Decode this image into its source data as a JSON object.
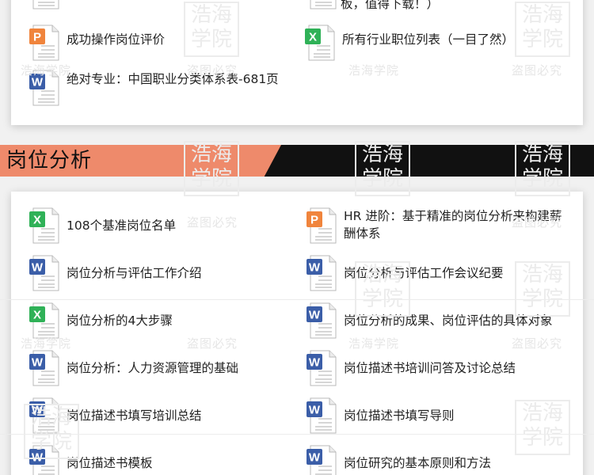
{
  "top_items": [
    {
      "type": "ppt",
      "label": "成功操作岗位评价"
    },
    {
      "type": "excel",
      "label": "所有行业职位列表（一目了然）"
    },
    {
      "type": "word",
      "label": "绝对专业：中国职业分类体系表-681页"
    }
  ],
  "top_partial_text": "板，值得下载！）",
  "section": {
    "title": "岗位分析"
  },
  "items": [
    {
      "type": "excel",
      "label": "108个基准岗位名单"
    },
    {
      "type": "ppt",
      "label": "HR 进阶：基于精准的岗位分析来构建薪酬体系"
    },
    {
      "type": "word",
      "label": "岗位分析与评估工作介绍"
    },
    {
      "type": "word",
      "label": "岗位分析与评估工作会议纪要"
    },
    {
      "type": "excel",
      "label": "岗位分析的4大步骤"
    },
    {
      "type": "word",
      "label": "岗位分析的成果、岗位评估的具体对象"
    },
    {
      "type": "word",
      "label": "岗位分析：人力资源管理的基础"
    },
    {
      "type": "word",
      "label": "岗位描述书培训问答及讨论总结"
    },
    {
      "type": "word",
      "label": "岗位描述书填写培训总结"
    },
    {
      "type": "word",
      "label": "岗位描述书填写导则"
    },
    {
      "type": "word",
      "label": "岗位描述书模板"
    },
    {
      "type": "word",
      "label": "岗位研究的基本原则和方法"
    }
  ],
  "watermarks": {
    "school": "浩海学院",
    "anti_theft": "盗图必究",
    "seal_top": "浩海",
    "seal_bottom": "学院"
  },
  "icon_colors": {
    "ppt": "#f0843c",
    "excel": "#2fb157",
    "word": "#3b5ea8"
  }
}
